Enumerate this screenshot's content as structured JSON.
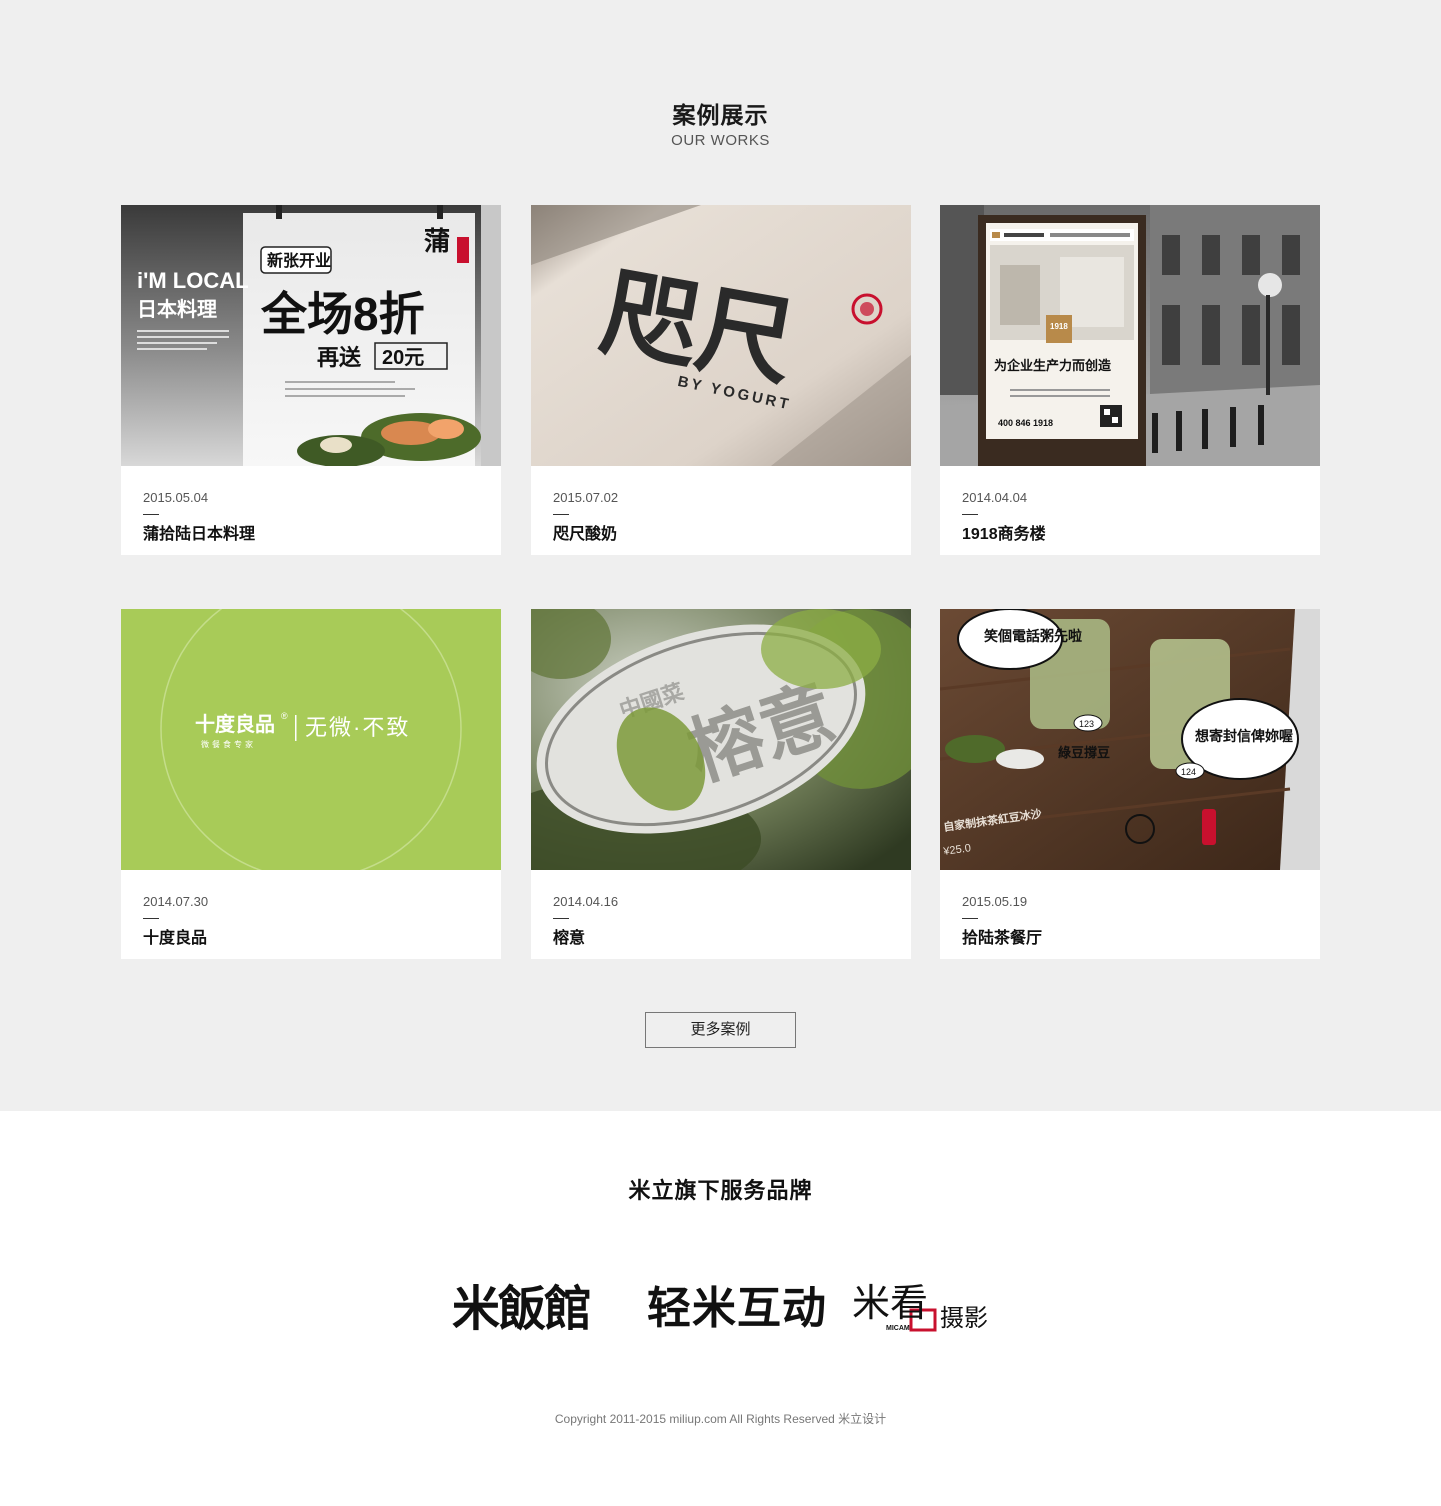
{
  "works": {
    "title": "案例展示",
    "subtitle": "OUR WORKS",
    "more_label": "更多案例",
    "items": [
      {
        "date": "2015.05.04",
        "name": "蒲拾陆日本料理",
        "thumb": {
          "left_brand": "i'M LOCAL",
          "left_brand_line2": "日本料理",
          "tag": "新张开业",
          "headline": "全场8折",
          "sub": "再送",
          "price": "20元",
          "seal": "蒲"
        }
      },
      {
        "date": "2015.07.02",
        "name": "咫尺酸奶",
        "thumb": {
          "logo": "咫尺",
          "tagline": "BY YOGURT"
        }
      },
      {
        "date": "2014.04.04",
        "name": "1918商务楼",
        "thumb": {
          "badge": "1918",
          "headline": "为企业生产力而创造",
          "phone": "400 846 1918"
        }
      },
      {
        "date": "2014.07.30",
        "name": "十度良品",
        "thumb": {
          "brand": "十度良品",
          "reg": "®",
          "brand_sub": "微餐食专家",
          "slogan": "无微·不致",
          "bg": "#a8cb58"
        }
      },
      {
        "date": "2014.04.16",
        "name": "榕意",
        "thumb": {
          "sign_small": "中國菜",
          "sign_big": "榕意"
        }
      },
      {
        "date": "2015.05.19",
        "name": "拾陆茶餐厅",
        "thumb": {
          "bubble_1": "笑個電話粥先啦",
          "bubble_2": "想寄封信俾妳喔",
          "label_1": "123",
          "label_2": "124",
          "menu_item": "自家制抹茶紅豆冰沙",
          "price": "¥25.0",
          "drink_label": "綠豆撐豆"
        }
      }
    ]
  },
  "brands": {
    "title": "米立旗下服务品牌",
    "items": [
      {
        "name": "米飯館"
      },
      {
        "name": "轻米互动"
      },
      {
        "name": "米看",
        "suffix": "摄影",
        "tag": "MICAM"
      }
    ]
  },
  "footer": {
    "copyright": "Copyright 2011-2015 miliup.com All Rights Reserved 米立设计"
  },
  "colors": {
    "section_bg": "#efefef",
    "accent_green": "#a8cb58",
    "brand_red": "#c8102e"
  }
}
